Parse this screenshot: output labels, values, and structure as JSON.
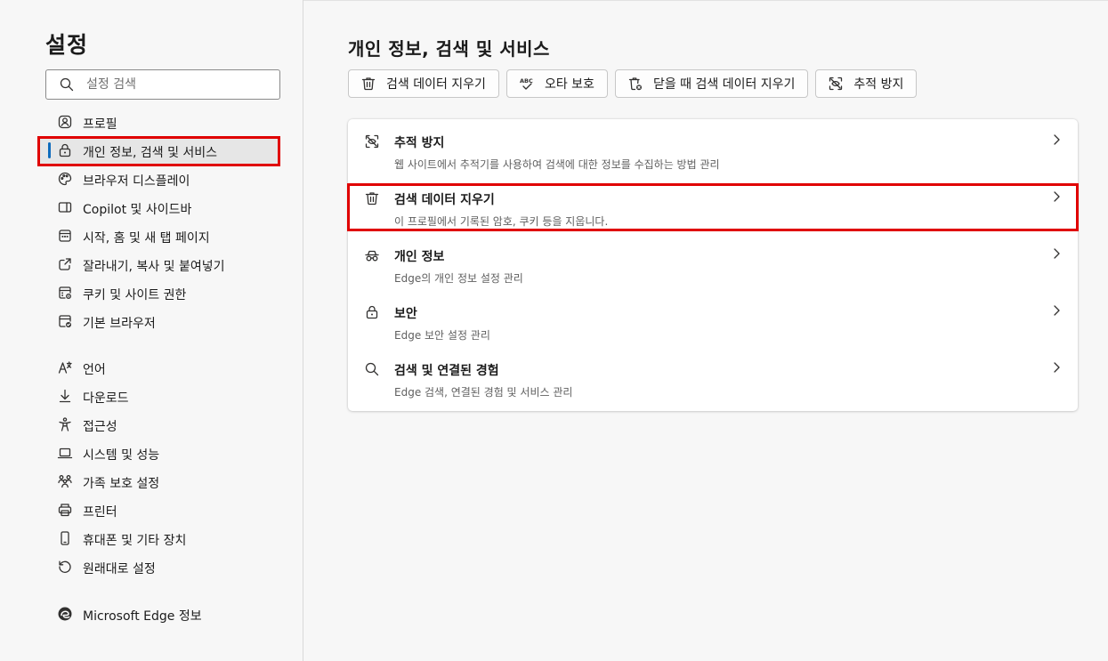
{
  "sidebar": {
    "title": "설정",
    "search_placeholder": "설정 검색",
    "items": [
      {
        "label": "프로필",
        "icon": "profile-icon"
      },
      {
        "label": "개인 정보, 검색 및 서비스",
        "icon": "lock-icon",
        "active": true
      },
      {
        "label": "브라우저 디스플레이",
        "icon": "palette-icon"
      },
      {
        "label": "Copilot 및 사이드바",
        "icon": "sidebar-icon"
      },
      {
        "label": "시작, 홈 및 새 탭 페이지",
        "icon": "home-grid-icon"
      },
      {
        "label": "잘라내기, 복사 및 붙여넣기",
        "icon": "share-icon"
      },
      {
        "label": "쿠키 및 사이트 권한",
        "icon": "cookie-settings-icon"
      },
      {
        "label": "기본 브라우저",
        "icon": "default-browser-icon"
      },
      {
        "label": "언어",
        "icon": "language-icon"
      },
      {
        "label": "다운로드",
        "icon": "download-icon"
      },
      {
        "label": "접근성",
        "icon": "accessibility-icon"
      },
      {
        "label": "시스템 및 성능",
        "icon": "laptop-icon"
      },
      {
        "label": "가족 보호 설정",
        "icon": "family-icon"
      },
      {
        "label": "프린터",
        "icon": "printer-icon"
      },
      {
        "label": "휴대폰 및 기타 장치",
        "icon": "phone-icon"
      },
      {
        "label": "원래대로 설정",
        "icon": "reset-icon"
      }
    ],
    "about_label": "Microsoft Edge 정보"
  },
  "main": {
    "title": "개인 정보, 검색 및 서비스",
    "quick_buttons": [
      {
        "label": "검색 데이터 지우기",
        "icon": "trash-icon"
      },
      {
        "label": "오타 보호",
        "icon": "spellcheck-icon"
      },
      {
        "label": "닫을 때 검색 데이터 지우기",
        "icon": "trash-clock-icon"
      },
      {
        "label": "추적 방지",
        "icon": "tracking-prevention-icon"
      }
    ],
    "rows": [
      {
        "title": "추적 방지",
        "desc": "웹 사이트에서 추적기를 사용하여 검색에 대한 정보를 수집하는 방법 관리",
        "icon": "tracking-prevention-icon"
      },
      {
        "title": "검색 데이터 지우기",
        "desc": "이 프로필에서 기록된 암호, 쿠키 등을 지웁니다.",
        "icon": "trash-icon"
      },
      {
        "title": "개인 정보",
        "desc": "Edge의 개인 정보 설정 관리",
        "icon": "incognito-glasses-icon"
      },
      {
        "title": "보안",
        "desc": "Edge 보안 설정 관리",
        "icon": "lock-icon"
      },
      {
        "title": "검색 및 연결된 경험",
        "desc": "Edge 검색, 연결된 경험 및 서비스 관리",
        "icon": "search-icon"
      }
    ]
  },
  "colors": {
    "accent": "#0f6cbd",
    "highlight_box": "#e00000",
    "background": "#f7f7f7",
    "card": "#ffffff"
  }
}
